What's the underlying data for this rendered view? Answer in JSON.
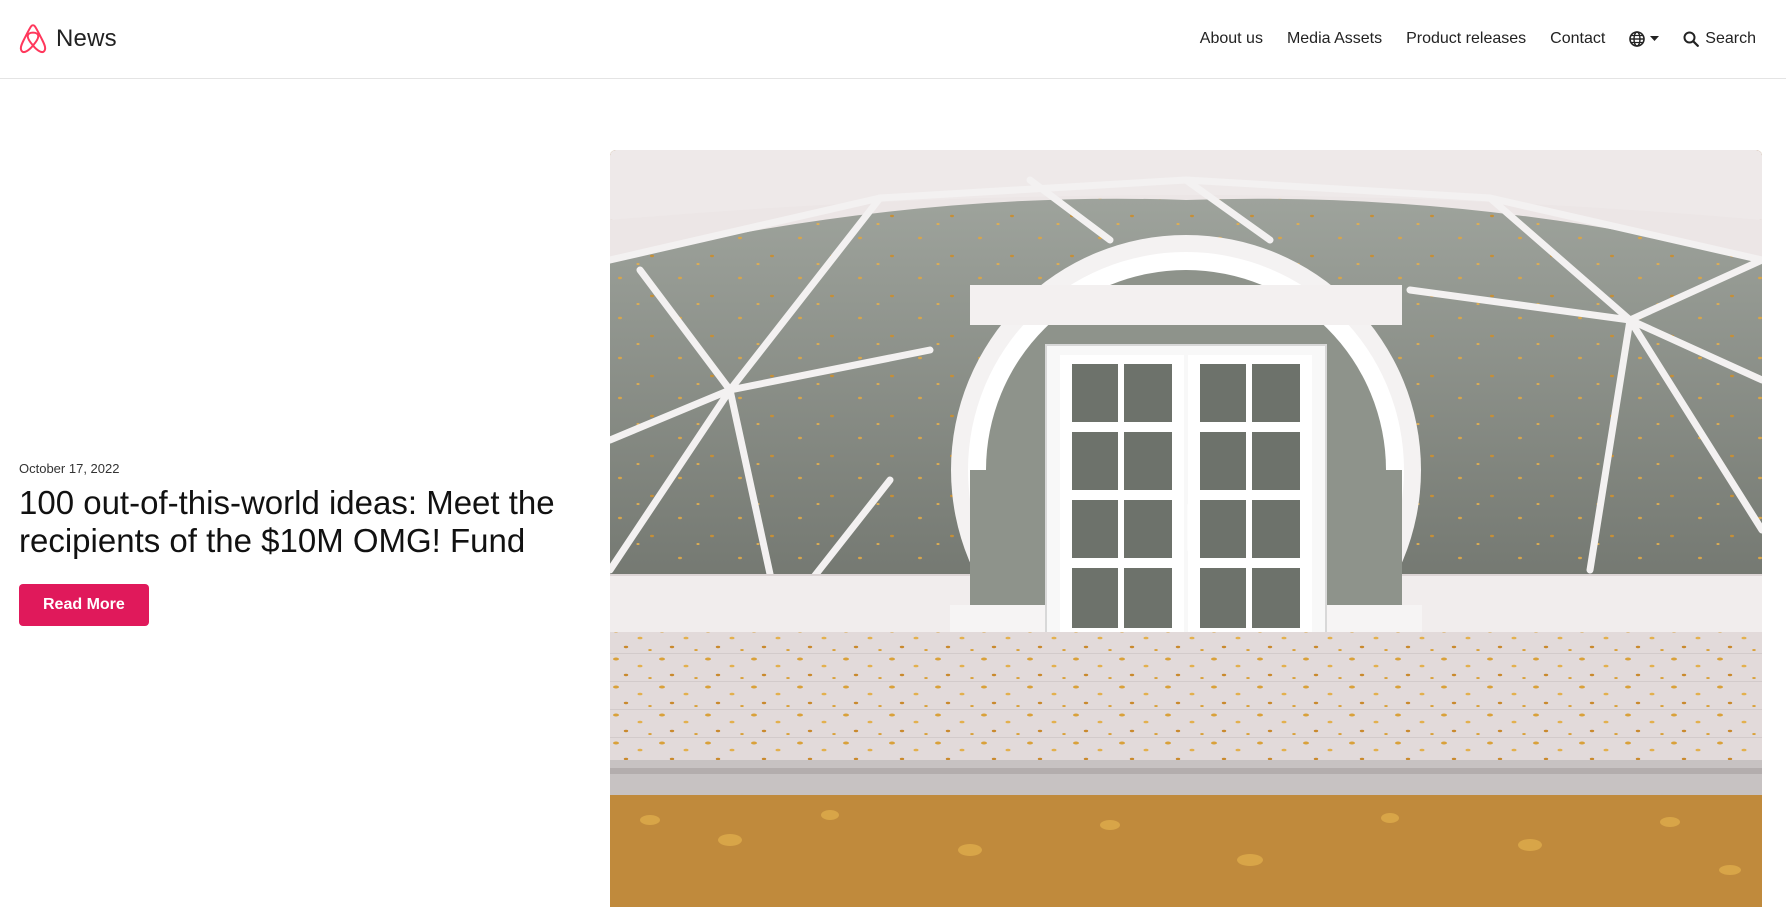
{
  "header": {
    "brand_name": "News",
    "nav": {
      "about": "About us",
      "media": "Media Assets",
      "releases": "Product releases",
      "contact": "Contact",
      "search": "Search"
    }
  },
  "hero": {
    "date": "October 17, 2022",
    "title": "100 out-of-this-world ideas: Meet the recipients of the $10M OMG! Fund",
    "cta_label": "Read More"
  },
  "colors": {
    "brand": "#ff385c",
    "cta": "#e0195b"
  },
  "icons": [
    "airbnb-logo-icon",
    "globe-icon",
    "caret-down-icon",
    "search-icon"
  ]
}
